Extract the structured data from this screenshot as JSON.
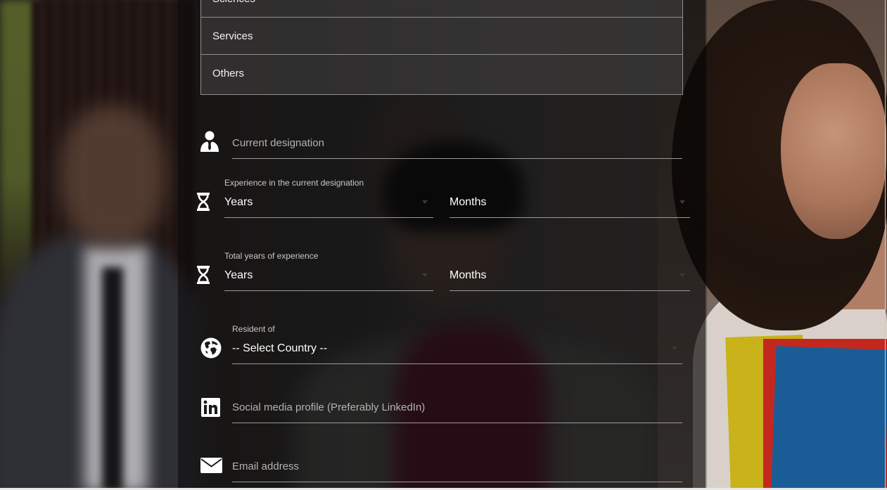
{
  "industry_dropdown": {
    "options": [
      "Sciences",
      "Services",
      "Others"
    ]
  },
  "designation": {
    "icon": "user-tie-icon",
    "placeholder": "Current designation"
  },
  "current_experience": {
    "icon": "hourglass-icon",
    "label": "Experience in the current designation",
    "years_value": "Years",
    "months_value": "Months"
  },
  "total_experience": {
    "icon": "hourglass-icon",
    "label": "Total years of experience",
    "years_value": "Years",
    "months_value": "Months"
  },
  "residence": {
    "icon": "globe-icon",
    "label": "Resident of",
    "value": "-- Select Country --"
  },
  "social": {
    "icon": "linkedin-icon",
    "placeholder": "Social media profile (Preferably LinkedIn)"
  },
  "email": {
    "icon": "envelope-icon",
    "placeholder": "Email address"
  },
  "colors": {
    "text": "#ffffff",
    "placeholder": "#b3b3b3",
    "underline": "#9b9b9b"
  }
}
